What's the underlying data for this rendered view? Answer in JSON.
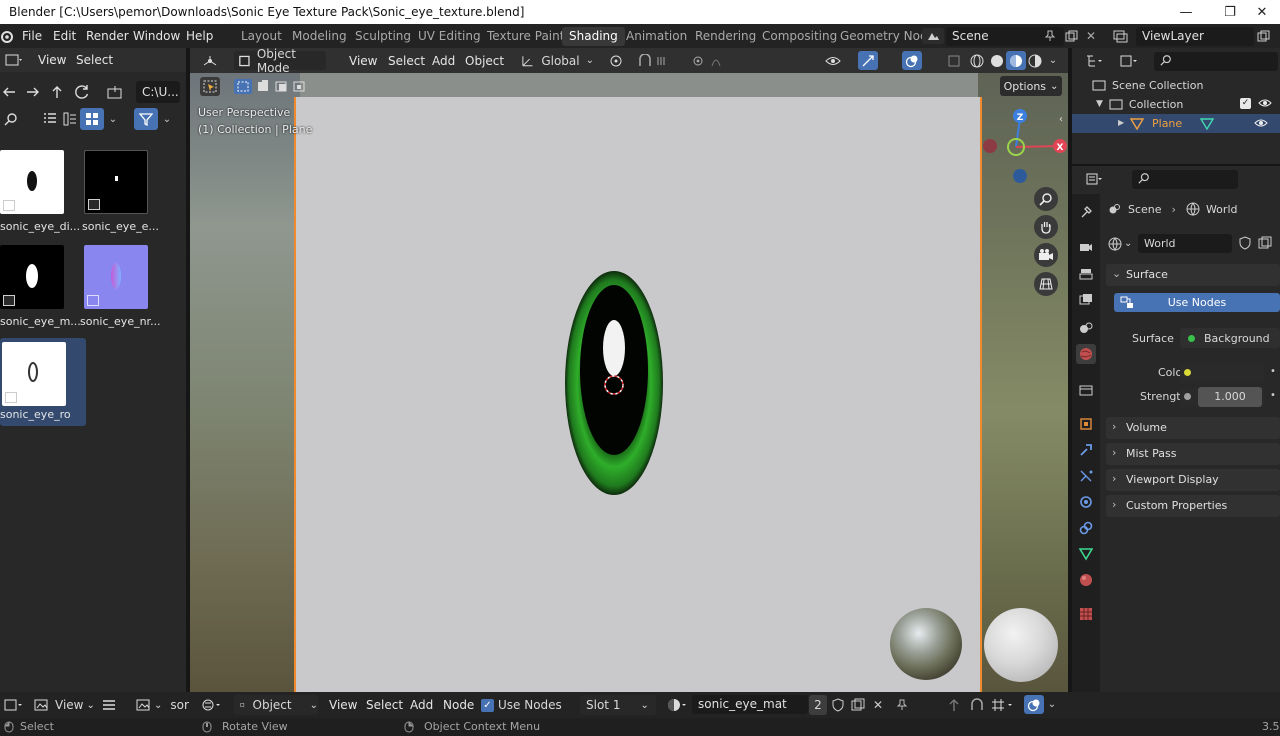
{
  "window": {
    "title": "Blender [C:\\Users\\pemor\\Downloads\\Sonic Eye Texture Pack\\Sonic_eye_texture.blend]",
    "minimize": "—",
    "maximize": "❐",
    "close": "✕"
  },
  "topbar": {
    "menus": [
      "File",
      "Edit",
      "Render",
      "Window",
      "Help"
    ],
    "workspaces": [
      "Layout",
      "Modeling",
      "Sculpting",
      "UV Editing",
      "Texture Paint",
      "Shading",
      "Animation",
      "Rendering",
      "Compositing",
      "Geometry Noc"
    ],
    "active_workspace": "Shading",
    "scene": "Scene",
    "view_layer": "ViewLayer"
  },
  "filebrowser": {
    "menus": [
      "View",
      "Select"
    ],
    "path": "C:\\U...",
    "images": [
      {
        "label": "sonic_eye_di...",
        "style": "white-dot"
      },
      {
        "label": "sonic_eye_e...",
        "style": "black-dot"
      },
      {
        "label": "sonic_eye_m...",
        "style": "black-oval"
      },
      {
        "label": "sonic_eye_nr...",
        "style": "normal"
      },
      {
        "label": "sonic_eye_ro...",
        "style": "white-ring"
      }
    ]
  },
  "viewport": {
    "mode": "Object Mode",
    "menus": [
      "View",
      "Select",
      "Add",
      "Object"
    ],
    "transform": "Global",
    "options": "Options",
    "overlay_line1": "User Perspective",
    "overlay_line2": "(1) Collection | Plane",
    "gizmo": {
      "z": "Z",
      "x": "X"
    }
  },
  "outliner": {
    "root": "Scene Collection",
    "collection": "Collection",
    "object": "Plane"
  },
  "properties": {
    "breadcrumb_scene": "Scene",
    "breadcrumb_world": "World",
    "world_name": "World",
    "surface_panel": "Surface",
    "use_nodes": "Use Nodes",
    "surface_label": "Surface",
    "surface_value": "Background",
    "color_label": "Color",
    "strength_label": "Strength",
    "strength_value": "1.000",
    "panels": [
      "Volume",
      "Mist Pass",
      "Viewport Display",
      "Custom Properties"
    ]
  },
  "node_header": {
    "view": "View",
    "image_name": "sor",
    "editor": "Object",
    "menus": [
      "View",
      "Select",
      "Add",
      "Node"
    ],
    "use_nodes": "Use Nodes",
    "slot": "Slot 1",
    "material": "sonic_eye_mat",
    "users": "2"
  },
  "statusbar": {
    "select": "Select",
    "rotate": "Rotate View",
    "context": "Object Context Menu",
    "version": "3.5"
  },
  "colors": {
    "accent_blue": "#4772b3",
    "selection_orange": "#f08a2c",
    "eye_green": "#2fae2a"
  }
}
